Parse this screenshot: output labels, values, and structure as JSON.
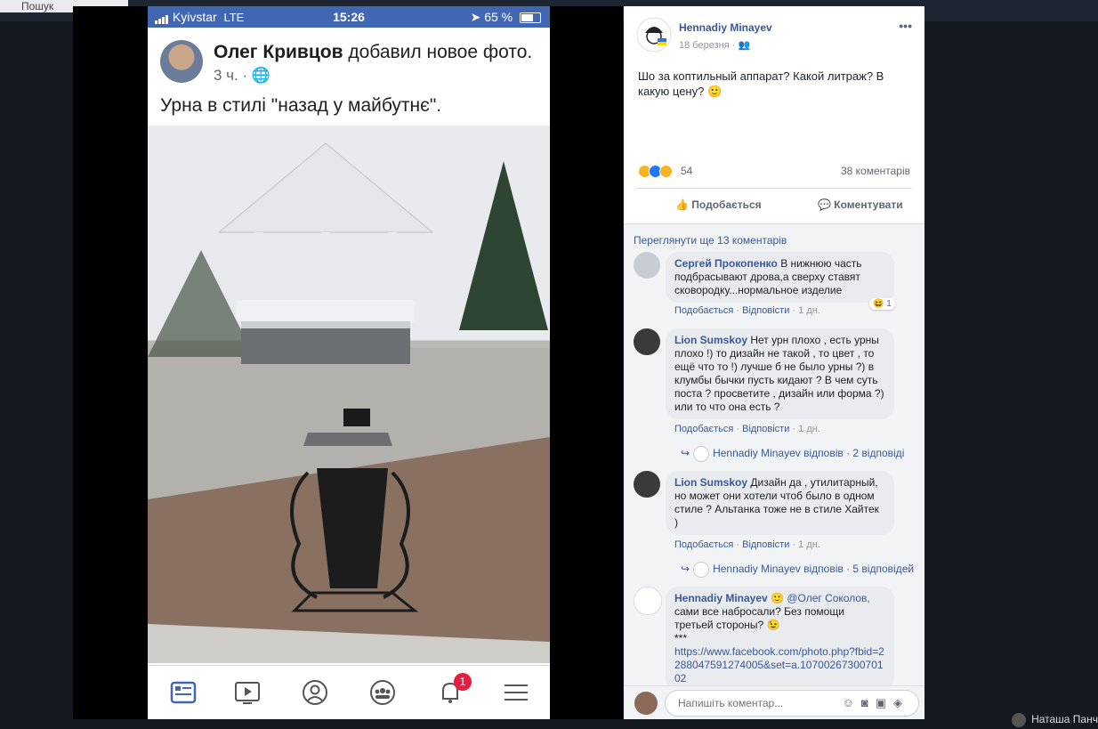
{
  "topbar": {
    "search_label": "Пошук",
    "user_name": "Наташа Панч"
  },
  "phone": {
    "carrier": "Kyivstar",
    "network": "LTE",
    "time": "15:26",
    "battery": "65 %",
    "battery_level": 0.65,
    "author": "Олег Кривцов",
    "action": "добавил новое фото.",
    "meta_time": "3 ч. ·",
    "caption": "Урна в стилі \"назад у майбутнє\".",
    "notification_count": "1"
  },
  "post": {
    "author": "Hennadiy Minayev",
    "date": "18 березня",
    "text": "Шо за коптильный аппарат? Какой литраж? В какую цену? 🙂",
    "reactions_count": "54",
    "comments_count": "38 коментарів",
    "like_label": "Подобається",
    "comment_label": "Коментувати",
    "view_more": "Переглянути ще 13 коментарів"
  },
  "comments": [
    {
      "author": "Сергей Прокопенко",
      "text": "В нижнюю часть подбрасывают дрова,а сверху ставят сковородку...нормальное изделие",
      "like": "Подобається",
      "reply": "Відповісти",
      "time": "1 дн.",
      "reaction_count": "1"
    },
    {
      "author": "Lion Sumskoy",
      "text": "Нет урн плохо , есть урны плохо !) то дизайн не такой , то цвет , то ещё что то !) лучше б не было урны ?) в клумбы бычки пусть кидают ? В чем суть поста ? просветите , дизайн или форма ?) или то что она есть ?",
      "like": "Подобається",
      "reply": "Відповісти",
      "time": "1 дн.",
      "replies_author": "Hennadiy Minayev відповів",
      "replies_count": "2 відповіді"
    },
    {
      "author": "Lion Sumskoy",
      "text": "Дизайн да , утилитарный, но может они хотели чтоб было в одном стиле ? Альтанка тоже не в стиле Хайтек )",
      "like": "Подобається",
      "reply": "Відповісти",
      "time": "1 дн.",
      "replies_author": "Hennadiy Minayev відповів",
      "replies_count": "5 відповідей"
    },
    {
      "author": "Hennadiy Minayev",
      "mention": "@Олег Соколов,",
      "text": "сами все набросали? Без помощи третьей стороны? 😉",
      "sep": "***",
      "link": "https://www.facebook.com/photo.php?fbid=2288047591274005&set=a.1070026730070102"
    }
  ],
  "input": {
    "placeholder": "Напишіть коментар..."
  }
}
